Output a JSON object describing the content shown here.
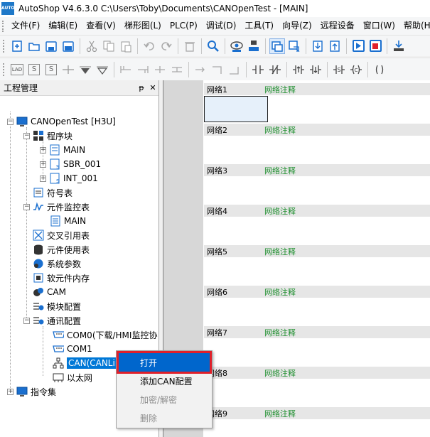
{
  "window": {
    "app_logo": "AUTO",
    "title": "AutoShop V4.6.3.0  C:\\Users\\Toby\\Documents\\CANOpenTest - [MAIN]"
  },
  "menubar": [
    "文件(F)",
    "编辑(E)",
    "查看(V)",
    "梯形图(L)",
    "PLC(P)",
    "调试(D)",
    "工具(T)",
    "向导(Z)",
    "远程设备",
    "窗口(W)",
    "帮助(H)"
  ],
  "toolbar1": [
    "new-icon",
    "open-icon",
    "save-icon",
    "save-all-icon",
    "cut-icon",
    "copy-icon",
    "paste-icon",
    "undo-icon",
    "redo-icon",
    "delete-icon",
    "find-icon",
    "monitor-icon",
    "network-icon",
    "window-icon",
    "window-cascade-icon",
    "download-icon",
    "upload-icon",
    "run-icon",
    "stop-icon",
    "plc-download-icon"
  ],
  "toolbar2_labels": {
    "lad": "LAD",
    "s1": "S",
    "s2": "S"
  },
  "panel": {
    "title": "工程管理",
    "pin": "ᵽ",
    "close": "✕",
    "tree": {
      "project": "CANOpenTest [H3U]",
      "program_blocks": "程序块",
      "main": "MAIN",
      "sbr": "SBR_001",
      "int": "INT_001",
      "symbol_table": "符号表",
      "monitor_table": "元件监控表",
      "monitor_main": "MAIN",
      "cross_ref": "交叉引用表",
      "usage_table": "元件使用表",
      "sys_params": "系统参数",
      "soft_memory": "软元件内存",
      "cam": "CAM",
      "module_config": "模块配置",
      "comm_config": "通讯配置",
      "com0": "COM0(下载/HMI监控协",
      "com1": "COM1",
      "can": "CAN(CANLink)",
      "ethernet": "以太网",
      "instruction_set": "指令集"
    }
  },
  "editor": {
    "networks": [
      {
        "name": "网络1",
        "comment": "网络注释"
      },
      {
        "name": "网络2",
        "comment": "网络注释"
      },
      {
        "name": "网络3",
        "comment": "网络注释"
      },
      {
        "name": "网络4",
        "comment": "网络注释"
      },
      {
        "name": "网络5",
        "comment": "网络注释"
      },
      {
        "name": "网络6",
        "comment": "网络注释"
      },
      {
        "name": "网络7",
        "comment": "网络注释"
      },
      {
        "name": "网络8",
        "comment": "网络注释"
      },
      {
        "name": "网络9",
        "comment": "网络注释"
      }
    ]
  },
  "context_menu": {
    "open": "打开",
    "add_can": "添加CAN配置",
    "encrypt": "加密/解密",
    "delete": "删除"
  },
  "colors": {
    "accent": "#0078d7",
    "menu_highlight": "#0066cc",
    "highlight_border": "#e0202a",
    "comment_green": "#1f8f2f"
  }
}
